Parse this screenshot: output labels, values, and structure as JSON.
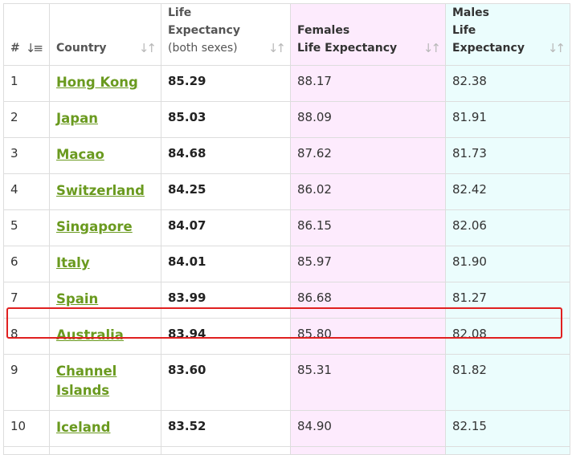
{
  "table": {
    "headers": {
      "rank": "#",
      "country": "Country",
      "both_line1": "Life Expectancy",
      "both_line2": "(both sexes)",
      "female_line1": "Females",
      "female_line2": "Life Expectancy",
      "male_line1": "Males",
      "male_line2": "Life Expectancy"
    },
    "rows": [
      {
        "rank": "1",
        "country": "Hong Kong",
        "both": "85.29",
        "female": "88.17",
        "male": "82.38"
      },
      {
        "rank": "2",
        "country": "Japan",
        "both": "85.03",
        "female": "88.09",
        "male": "81.91"
      },
      {
        "rank": "3",
        "country": "Macao",
        "both": "84.68",
        "female": "87.62",
        "male": "81.73"
      },
      {
        "rank": "4",
        "country": "Switzerland",
        "both": "84.25",
        "female": "86.02",
        "male": "82.42"
      },
      {
        "rank": "5",
        "country": "Singapore",
        "both": "84.07",
        "female": "86.15",
        "male": "82.06"
      },
      {
        "rank": "6",
        "country": "Italy",
        "both": "84.01",
        "female": "85.97",
        "male": "81.90"
      },
      {
        "rank": "7",
        "country": "Spain",
        "both": "83.99",
        "female": "86.68",
        "male": "81.27"
      },
      {
        "rank": "8",
        "country": "Australia",
        "both": "83.94",
        "female": "85.80",
        "male": "82.08"
      },
      {
        "rank": "9",
        "country": "Channel Islands",
        "both": "83.60",
        "female": "85.31",
        "male": "81.82"
      },
      {
        "rank": "10",
        "country": "Iceland",
        "both": "83.52",
        "female": "84.90",
        "male": "82.15"
      }
    ],
    "highlighted_row": "8"
  },
  "colors": {
    "link": "#6a9a1f",
    "female_bg": "#fdebfd",
    "male_bg": "#ebfdfd",
    "highlight_border": "#e02020"
  },
  "icons": {
    "rank_sort": "sort-descending-numeric-icon",
    "column_sort": "sort-arrows-icon"
  }
}
